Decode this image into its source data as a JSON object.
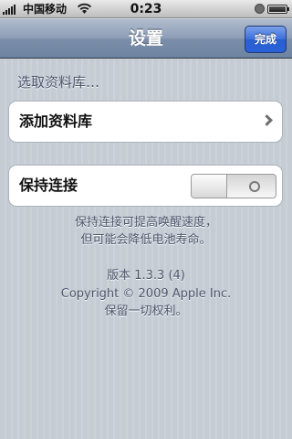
{
  "status_bar": {
    "carrier": "中国移动",
    "time": "0:23"
  },
  "nav": {
    "title": "设置",
    "done_label": "完成"
  },
  "library": {
    "section_header": "选取资料库…",
    "add_label": "添加资料库"
  },
  "keep_alive": {
    "label": "保持连接",
    "toggle_on": false
  },
  "footer": {
    "note_line1": "保持连接可提高唤醒速度，",
    "note_line2": "但可能会降低电池寿命。",
    "version": "版本 1.3.3 (4)",
    "copyright": "Copyright © 2009 Apple Inc.",
    "rights": "保留一切权利。"
  },
  "icons": {
    "signal": "signal-bars-icon",
    "wifi": "wifi-icon",
    "lock": "rotation-lock-icon",
    "battery": "battery-icon",
    "chevron": "chevron-right-icon"
  },
  "colors": {
    "done_button": "#2a5fd0",
    "nav_bar": "#6d84a2",
    "background": "#c5ccd4",
    "footer_text": "#4c566c"
  }
}
